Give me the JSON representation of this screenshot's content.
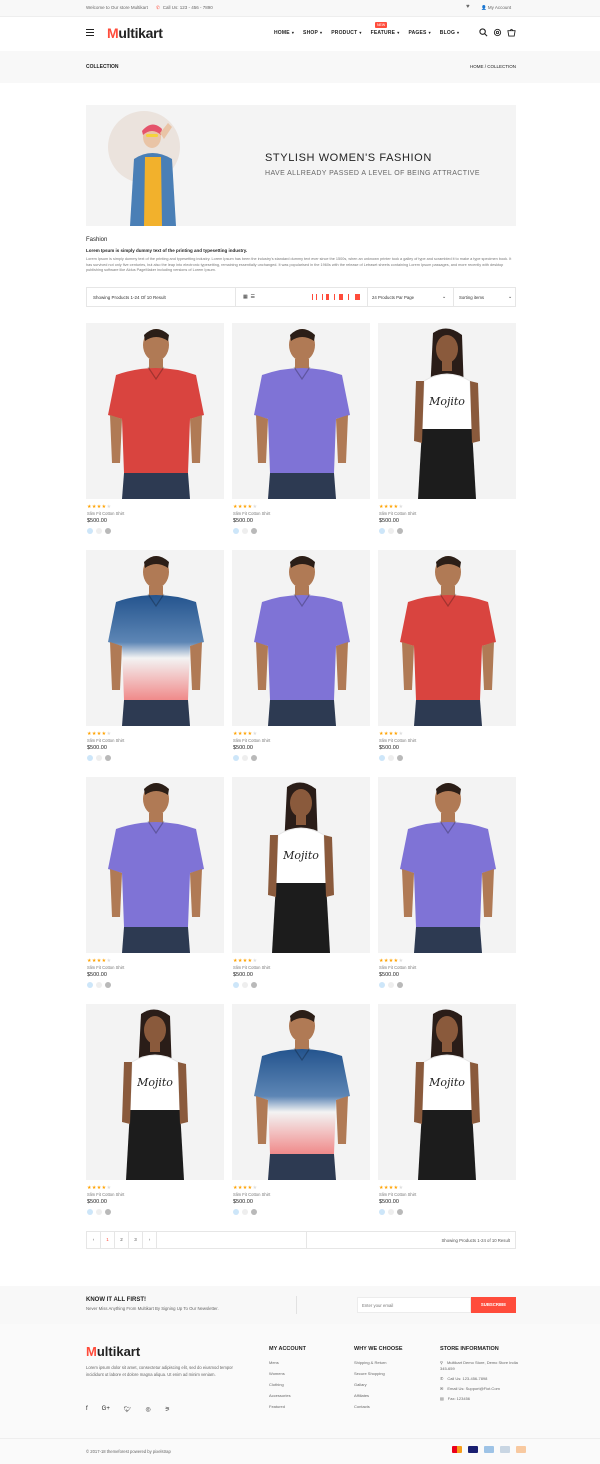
{
  "topbar": {
    "welcome": "Welcome to Our store Multikart",
    "call": "Call Us: 123 - 456 - 7890",
    "account": "My Account"
  },
  "header": {
    "logo_m": "M",
    "logo_rest": "ultikart",
    "nav": [
      "HOME",
      "SHOP",
      "PRODUCT",
      "FEATURE",
      "PAGES",
      "BLOG"
    ],
    "new_badge": "NEW"
  },
  "breadcrumb": {
    "label": "COLLECTION",
    "path": "HOME / COLLECTION"
  },
  "banner": {
    "title": "STYLISH WOMEN'S FASHION",
    "subtitle": "HAVE ALLREADY PASSED A LEVEL OF BEING ATTRACTIVE"
  },
  "category": {
    "title": "Fashion",
    "subtitle": "Lorem Ipsum is simply dummy text of the printing and typesetting industry.",
    "description": "Lorem Ipsum is simply dummy text of the printing and typesetting industry. Lorem Ipsum has been the industry's standard dummy text ever since the 1500s, when an unknown printer took a galley of type and scrambled it to make a type specimen book. It has survived not only five centuries, but also the leap into electronic typesetting, remaining essentially unchanged. It was popularised in the 1960s with the release of Letraset sheets containing Lorem Ipsum passages, and more recently with desktop publishing software like Aldus PageMaker including versions of Lorem Ipsum."
  },
  "filter": {
    "showing": "Showing Products 1-24 Of 10 Result",
    "per_page": "24 Products Par Page",
    "sorting": "Sorting items"
  },
  "products": [
    {
      "name": "Slim Fit Cotton Shirt",
      "price": "$500.00",
      "rating": 4,
      "type": "red"
    },
    {
      "name": "Slim Fit Cotton Shirt",
      "price": "$500.00",
      "rating": 4,
      "type": "purple"
    },
    {
      "name": "Slim Fit Cotton Shirt",
      "price": "$500.00",
      "rating": 4,
      "type": "woman"
    },
    {
      "name": "Slim Fit Cotton Shirt",
      "price": "$500.00",
      "rating": 4,
      "type": "blue"
    },
    {
      "name": "Slim Fit Cotton Shirt",
      "price": "$500.00",
      "rating": 4,
      "type": "purple"
    },
    {
      "name": "Slim Fit Cotton Shirt",
      "price": "$500.00",
      "rating": 4,
      "type": "red"
    },
    {
      "name": "Slim Fit Cotton Shirt",
      "price": "$500.00",
      "rating": 4,
      "type": "purple"
    },
    {
      "name": "Slim Fit Cotton Shirt",
      "price": "$500.00",
      "rating": 4,
      "type": "woman"
    },
    {
      "name": "Slim Fit Cotton Shirt",
      "price": "$500.00",
      "rating": 4,
      "type": "purple"
    },
    {
      "name": "Slim Fit Cotton Shirt",
      "price": "$500.00",
      "rating": 4,
      "type": "woman"
    },
    {
      "name": "Slim Fit Cotton Shirt",
      "price": "$500.00",
      "rating": 4,
      "type": "blue"
    },
    {
      "name": "Slim Fit Cotton Shirt",
      "price": "$500.00",
      "rating": 4,
      "type": "woman"
    }
  ],
  "swatch_colors": [
    "#cde6f9",
    "#eeeeee",
    "#b9b9b9"
  ],
  "shirt_colors": {
    "red": "#d9443f",
    "purple": "#7f73d6",
    "blue": "#24548e",
    "woman": "#ffffff"
  },
  "pagination": {
    "pages": [
      "‹",
      "1",
      "2",
      "3",
      "›"
    ],
    "result": "Showing Products 1-24 of 10 Result"
  },
  "newsletter": {
    "title": "KNOW IT ALL FIRST!",
    "subtitle": "Never Miss Anything From Multikart By Signing Up To Our Newsletter.",
    "placeholder": "Enter your email",
    "button": "SUBSCRIBE"
  },
  "footer": {
    "about": "Lorem ipsum dolor sit amet, consectetur adipiscing elit, sed do eiusmod tempor incididunt ut labore et dolore magna aliqua. Ut enim ad minim veniam.",
    "my_account_title": "MY ACCOUNT",
    "my_account": [
      "Mens",
      "Womens",
      "Clothing",
      "Accessories",
      "Featured"
    ],
    "why_title": "WHY WE CHOOSE",
    "why": [
      "Shipping & Return",
      "Secure Shopping",
      "Gallary",
      "Affiliates",
      "Contacts"
    ],
    "store_title": "STORE INFORMATION",
    "store_address": "Multikart Demo Store, Demo Store India 345-659",
    "store_call": "Call Us: 123-456-7898",
    "store_email": "Email Us: Support@Fiot.Com",
    "store_fax": "Fax: 123456",
    "copyright": "© 2017-18 themeforest powered by pixelstrap"
  },
  "accent_color": "#ff4c3b"
}
